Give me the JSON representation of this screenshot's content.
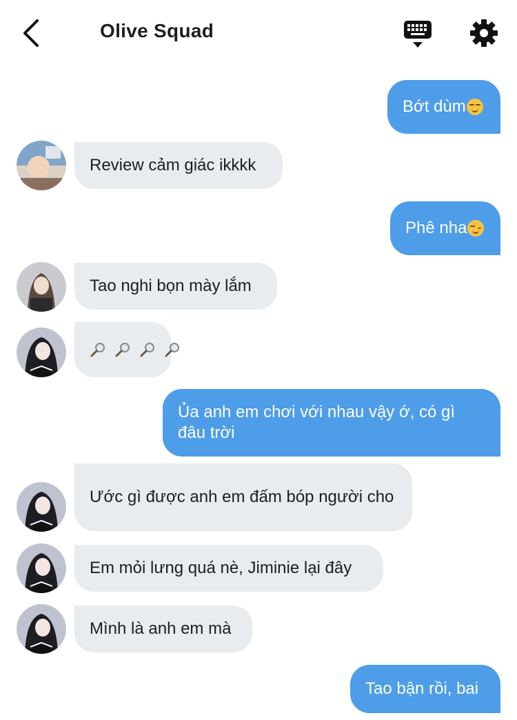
{
  "header": {
    "title": "Olive Squad",
    "back_icon": "chevron-left-icon",
    "keyboard_icon": "keyboard-icon",
    "settings_icon": "gear-icon"
  },
  "colors": {
    "outgoing_bubble": "#4d9de9",
    "incoming_bubble": "#e9ecef",
    "text": "#1c1e21"
  },
  "messages": [
    {
      "direction": "out",
      "text": "Bớt dùm",
      "emoji": "smirking-face"
    },
    {
      "direction": "in",
      "text": "Review cảm giác ikkkk",
      "avatar": "avatar-1"
    },
    {
      "direction": "out",
      "text": "Phê nha",
      "emoji": "smirking-face"
    },
    {
      "direction": "in",
      "text": "Tao nghi bọn mày lắm",
      "avatar": "avatar-2"
    },
    {
      "direction": "in",
      "text": "",
      "emoji": "magnifying-glass x4",
      "avatar": "avatar-3"
    },
    {
      "direction": "out",
      "text": "Ủa anh em chơi với nhau vậy ớ, có gì đâu trời"
    },
    {
      "direction": "in",
      "text": "Ước gì được anh em đấm bóp người cho",
      "avatar": "avatar-3"
    },
    {
      "direction": "in",
      "text": "Em mỏi lưng quá nè, Jiminie lại đây",
      "avatar": "avatar-3"
    },
    {
      "direction": "in",
      "text": "Mình là anh em mà",
      "avatar": "avatar-3"
    },
    {
      "direction": "out",
      "text": "Tao bận rồi, bai"
    }
  ]
}
